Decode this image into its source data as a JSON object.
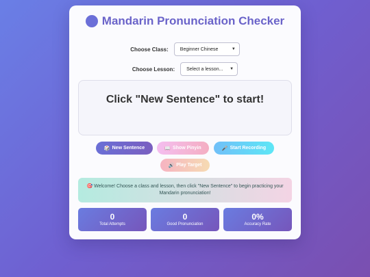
{
  "app": {
    "title": "Mandarin Pronunciation Checker"
  },
  "controls": {
    "class_label": "Choose Class:",
    "class_value": "Beginner Chinese",
    "lesson_label": "Choose Lesson:",
    "lesson_value": "Select a lesson..."
  },
  "display": {
    "text": "Click \"New Sentence\" to start!"
  },
  "buttons": {
    "new_sentence": {
      "icon": "🎲",
      "label": "New Sentence"
    },
    "show_pinyin": {
      "icon": "📖",
      "label": "Show Pinyin"
    },
    "start_recording": {
      "icon": "🎤",
      "label": "Start Recording"
    },
    "play_target": {
      "icon": "🔊",
      "label": "Play Target"
    }
  },
  "message": {
    "icon": "🎯",
    "text": "Welcome! Choose a class and lesson, then click \"New Sentence\" to begin practicing your Mandarin pronunciation!"
  },
  "stats": [
    {
      "value": "0",
      "label": "Total Attempts"
    },
    {
      "value": "0",
      "label": "Good Pronunciation"
    },
    {
      "value": "0%",
      "label": "Accuracy Rate"
    }
  ],
  "colors": {
    "accent": "#6a63c9",
    "background_start": "#6a7fe6",
    "background_end": "#7a4fb0"
  }
}
